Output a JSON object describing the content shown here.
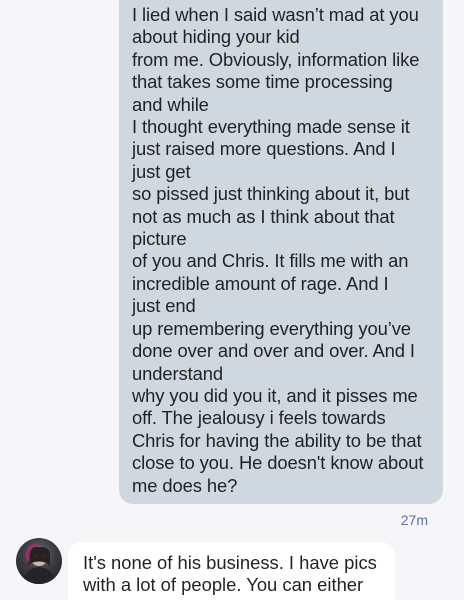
{
  "conversation": {
    "sent_message": {
      "text": "I lied when I said wasn’t mad at you\nabout hiding your kid\nfrom me. Obviously, information like\nthat takes some time processing\nand while\nI thought everything made sense it\njust raised more questions. And I\njust get\nso pissed just thinking about it, but\nnot as much as I think about that\npicture\nof you and Chris. It fills me with an\nincredible amount of rage. And I\njust end\nup remembering everything you’ve\ndone over and over and over. And I\nunderstand\nwhy you did you it, and it pisses me\noff. The jealousy i feels towards\nChris for having the ability to be that\nclose to you. He doesn't know about\nme does he?",
      "timestamp": "27m"
    },
    "received_message": {
      "text": "It's none of his business. I have pics\nwith a lot of people. You can either"
    }
  },
  "colors": {
    "sent_bubble": "#cfd8df",
    "received_bubble": "#ffffff",
    "background": "#f6f6f8",
    "timestamp": "#5b6fa8"
  }
}
